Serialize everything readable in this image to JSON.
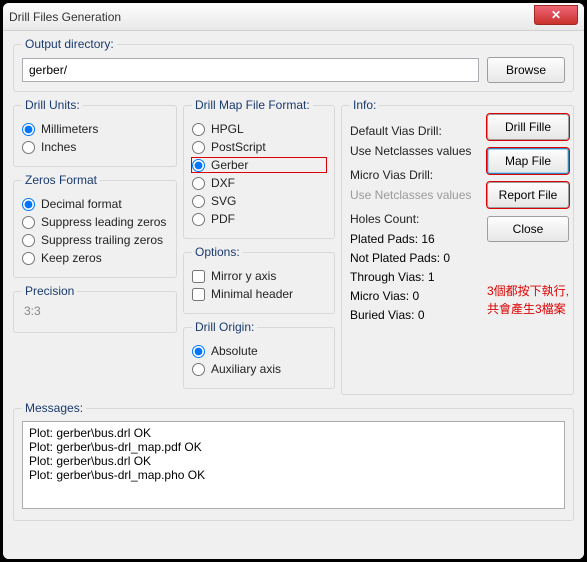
{
  "window": {
    "title": "Drill Files Generation",
    "close_glyph": "✕"
  },
  "output": {
    "legend": "Output directory:",
    "value": "gerber/",
    "browse": "Browse"
  },
  "units": {
    "legend": "Drill Units:",
    "opts": [
      "Millimeters",
      "Inches"
    ],
    "selected": 0
  },
  "zeros": {
    "legend": "Zeros Format",
    "opts": [
      "Decimal format",
      "Suppress leading zeros",
      "Suppress trailing zeros",
      "Keep zeros"
    ],
    "selected": 0
  },
  "precision": {
    "label": "Precision",
    "value": "3:3"
  },
  "map": {
    "legend": "Drill Map File Format:",
    "opts": [
      "HPGL",
      "PostScript",
      "Gerber",
      "DXF",
      "SVG",
      "PDF"
    ],
    "selected": 2
  },
  "options": {
    "legend": "Options:",
    "opts": [
      "Mirror y axis",
      "Minimal header"
    ]
  },
  "origin": {
    "legend": "Drill Origin:",
    "opts": [
      "Absolute",
      "Auxiliary axis"
    ],
    "selected": 0
  },
  "info": {
    "legend": "Info:",
    "default_vias": "Default Vias Drill:",
    "default_vias_val": "Use Netclasses values",
    "micro_vias": "Micro Vias Drill:",
    "micro_vias_val": "Use Netclasses values",
    "holes_head": "Holes Count:",
    "holes": {
      "plated": "Plated Pads: 16",
      "not_plated": "Not Plated Pads: 0",
      "through": "Through Vias: 1",
      "micro": "Micro Vias: 0",
      "buried": "Buried Vias: 0"
    }
  },
  "buttons": {
    "drill": "Drill Fille",
    "map": "Map File",
    "report": "Report File",
    "close": "Close"
  },
  "annotation": {
    "l1": "3個都按下執行,",
    "l2": "共會產生3檔案"
  },
  "messages": {
    "legend": "Messages:",
    "text": "Plot: gerber\\bus.drl OK\nPlot: gerber\\bus-drl_map.pdf OK\nPlot: gerber\\bus.drl OK\nPlot: gerber\\bus-drl_map.pho OK"
  }
}
